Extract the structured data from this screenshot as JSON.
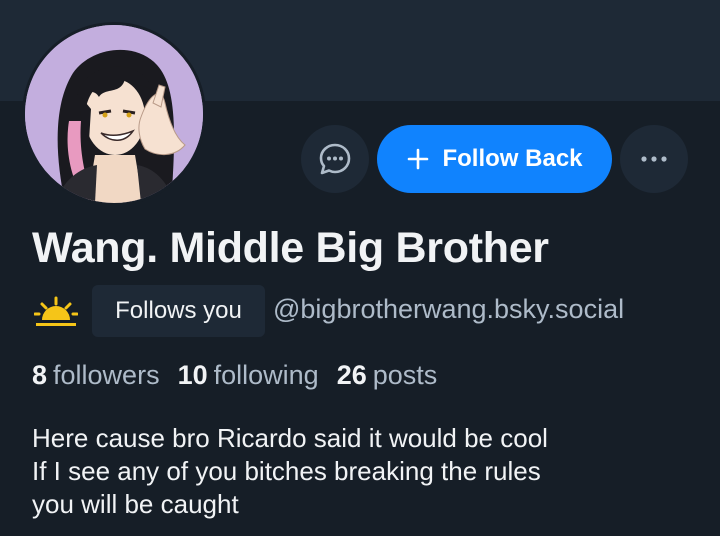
{
  "profile": {
    "display_name": "Wang. Middle Big Brother",
    "handle": "@bigbrotherwang.bsky.social",
    "follows_you_label": "Follows you",
    "bio_lines": [
      "Here cause bro Ricardo said it would be cool",
      "If I see any of you bitches breaking the rules",
      "you will be caught"
    ]
  },
  "stats": {
    "followers_count": "8",
    "followers_label": "followers",
    "following_count": "10",
    "following_label": "following",
    "posts_count": "26",
    "posts_label": "posts"
  },
  "actions": {
    "follow_back_label": "Follow Back",
    "message_icon": "message-bubble-icon",
    "more_icon": "ellipsis-icon",
    "plus_icon": "plus-icon"
  },
  "colors": {
    "background": "#161e27",
    "banner": "#1e2936",
    "accent": "#1083fe",
    "text": "#f1f3f5",
    "muted": "#aebbc9",
    "sun": "#f5c518"
  }
}
